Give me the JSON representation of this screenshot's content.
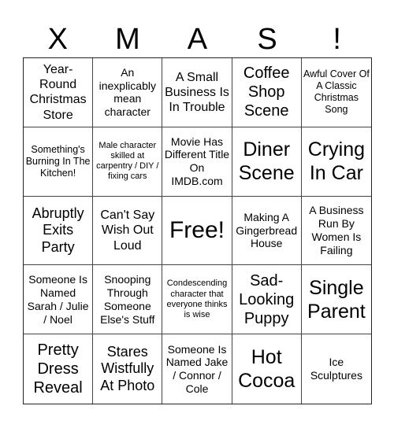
{
  "header": {
    "letters": [
      "X",
      "M",
      "A",
      "S",
      "!"
    ]
  },
  "cells": [
    "Year-Round Christmas Store",
    "An inexplicably mean character",
    "A Small Business Is In Trouble",
    "Coffee Shop Scene",
    "Awful Cover Of A Classic Christmas Song",
    "Something's Burning In The Kitchen!",
    "Male character skilled at carpentry / DIY / fixing cars",
    "Movie Has Different Title On IMDB.com",
    "Diner Scene",
    "Crying In Car",
    "Abruptly Exits Party",
    "Can't Say Wish Out Loud",
    "Free!",
    "Making A Gingerbread House",
    "A Business Run By Women Is Failing",
    "Someone Is Named Sarah / Julie / Noel",
    "Snooping Through Someone Else's Stuff",
    "Condescending character that everyone thinks is wise",
    "Sad-Looking Puppy",
    "Single Parent",
    "Pretty Dress Reveal",
    "Stares Wistfully At Photo",
    "Someone Is Named Jake / Connor / Cole",
    "Hot Cocoa",
    "Ice Sculptures"
  ]
}
